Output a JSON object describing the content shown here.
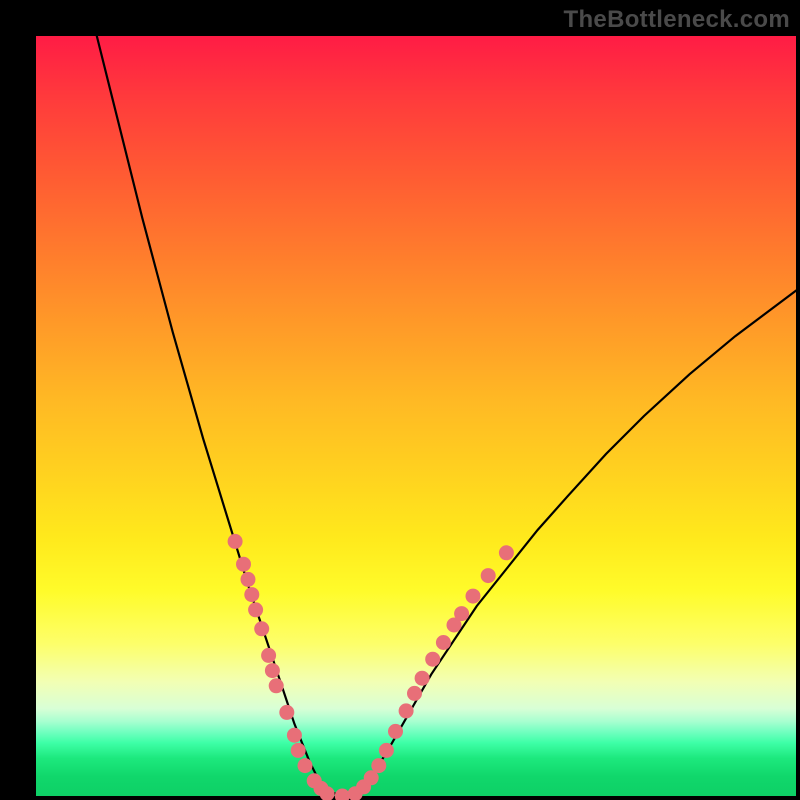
{
  "watermark": "TheBottleneck.com",
  "chart_data": {
    "type": "line",
    "title": "",
    "xlabel": "",
    "ylabel": "",
    "xlim": [
      0,
      100
    ],
    "ylim": [
      0,
      100
    ],
    "series": [
      {
        "name": "bottleneck-curve",
        "x": [
          8,
          10,
          12,
          14,
          16,
          18,
          20,
          22,
          24,
          26,
          28,
          30,
          32,
          33,
          34,
          35,
          36,
          37,
          38,
          40,
          42,
          44,
          46,
          48,
          50,
          52,
          55,
          58,
          62,
          66,
          70,
          75,
          80,
          86,
          92,
          100
        ],
        "values": [
          100,
          92,
          84,
          76,
          68.5,
          61,
          54,
          47,
          40.5,
          34,
          27.5,
          21.5,
          15.5,
          12.5,
          9.5,
          7,
          4.5,
          2.5,
          1,
          0,
          0.5,
          2.5,
          5.5,
          9,
          12.5,
          16,
          20.5,
          25,
          30,
          35,
          39.5,
          45,
          50,
          55.5,
          60.5,
          66.5
        ]
      }
    ],
    "markers": [
      {
        "x": 26.2,
        "y": 33.5
      },
      {
        "x": 27.3,
        "y": 30.5
      },
      {
        "x": 27.9,
        "y": 28.5
      },
      {
        "x": 28.4,
        "y": 26.5
      },
      {
        "x": 28.9,
        "y": 24.5
      },
      {
        "x": 29.7,
        "y": 22
      },
      {
        "x": 30.6,
        "y": 18.5
      },
      {
        "x": 31.1,
        "y": 16.5
      },
      {
        "x": 31.6,
        "y": 14.5
      },
      {
        "x": 33.0,
        "y": 11
      },
      {
        "x": 34.0,
        "y": 8
      },
      {
        "x": 34.5,
        "y": 6
      },
      {
        "x": 35.4,
        "y": 4
      },
      {
        "x": 36.6,
        "y": 2
      },
      {
        "x": 37.5,
        "y": 1
      },
      {
        "x": 38.3,
        "y": 0.3
      },
      {
        "x": 40.3,
        "y": 0
      },
      {
        "x": 42.0,
        "y": 0.3
      },
      {
        "x": 43.1,
        "y": 1.2
      },
      {
        "x": 44.1,
        "y": 2.4
      },
      {
        "x": 45.1,
        "y": 4
      },
      {
        "x": 46.1,
        "y": 6
      },
      {
        "x": 47.3,
        "y": 8.5
      },
      {
        "x": 48.7,
        "y": 11.2
      },
      {
        "x": 49.8,
        "y": 13.5
      },
      {
        "x": 50.8,
        "y": 15.5
      },
      {
        "x": 52.2,
        "y": 18
      },
      {
        "x": 53.6,
        "y": 20.2
      },
      {
        "x": 55.0,
        "y": 22.5
      },
      {
        "x": 56.0,
        "y": 24
      },
      {
        "x": 57.5,
        "y": 26.3
      },
      {
        "x": 59.5,
        "y": 29
      },
      {
        "x": 61.9,
        "y": 32
      }
    ],
    "colors": {
      "curve": "#000000",
      "markers": "#e86f78"
    }
  }
}
